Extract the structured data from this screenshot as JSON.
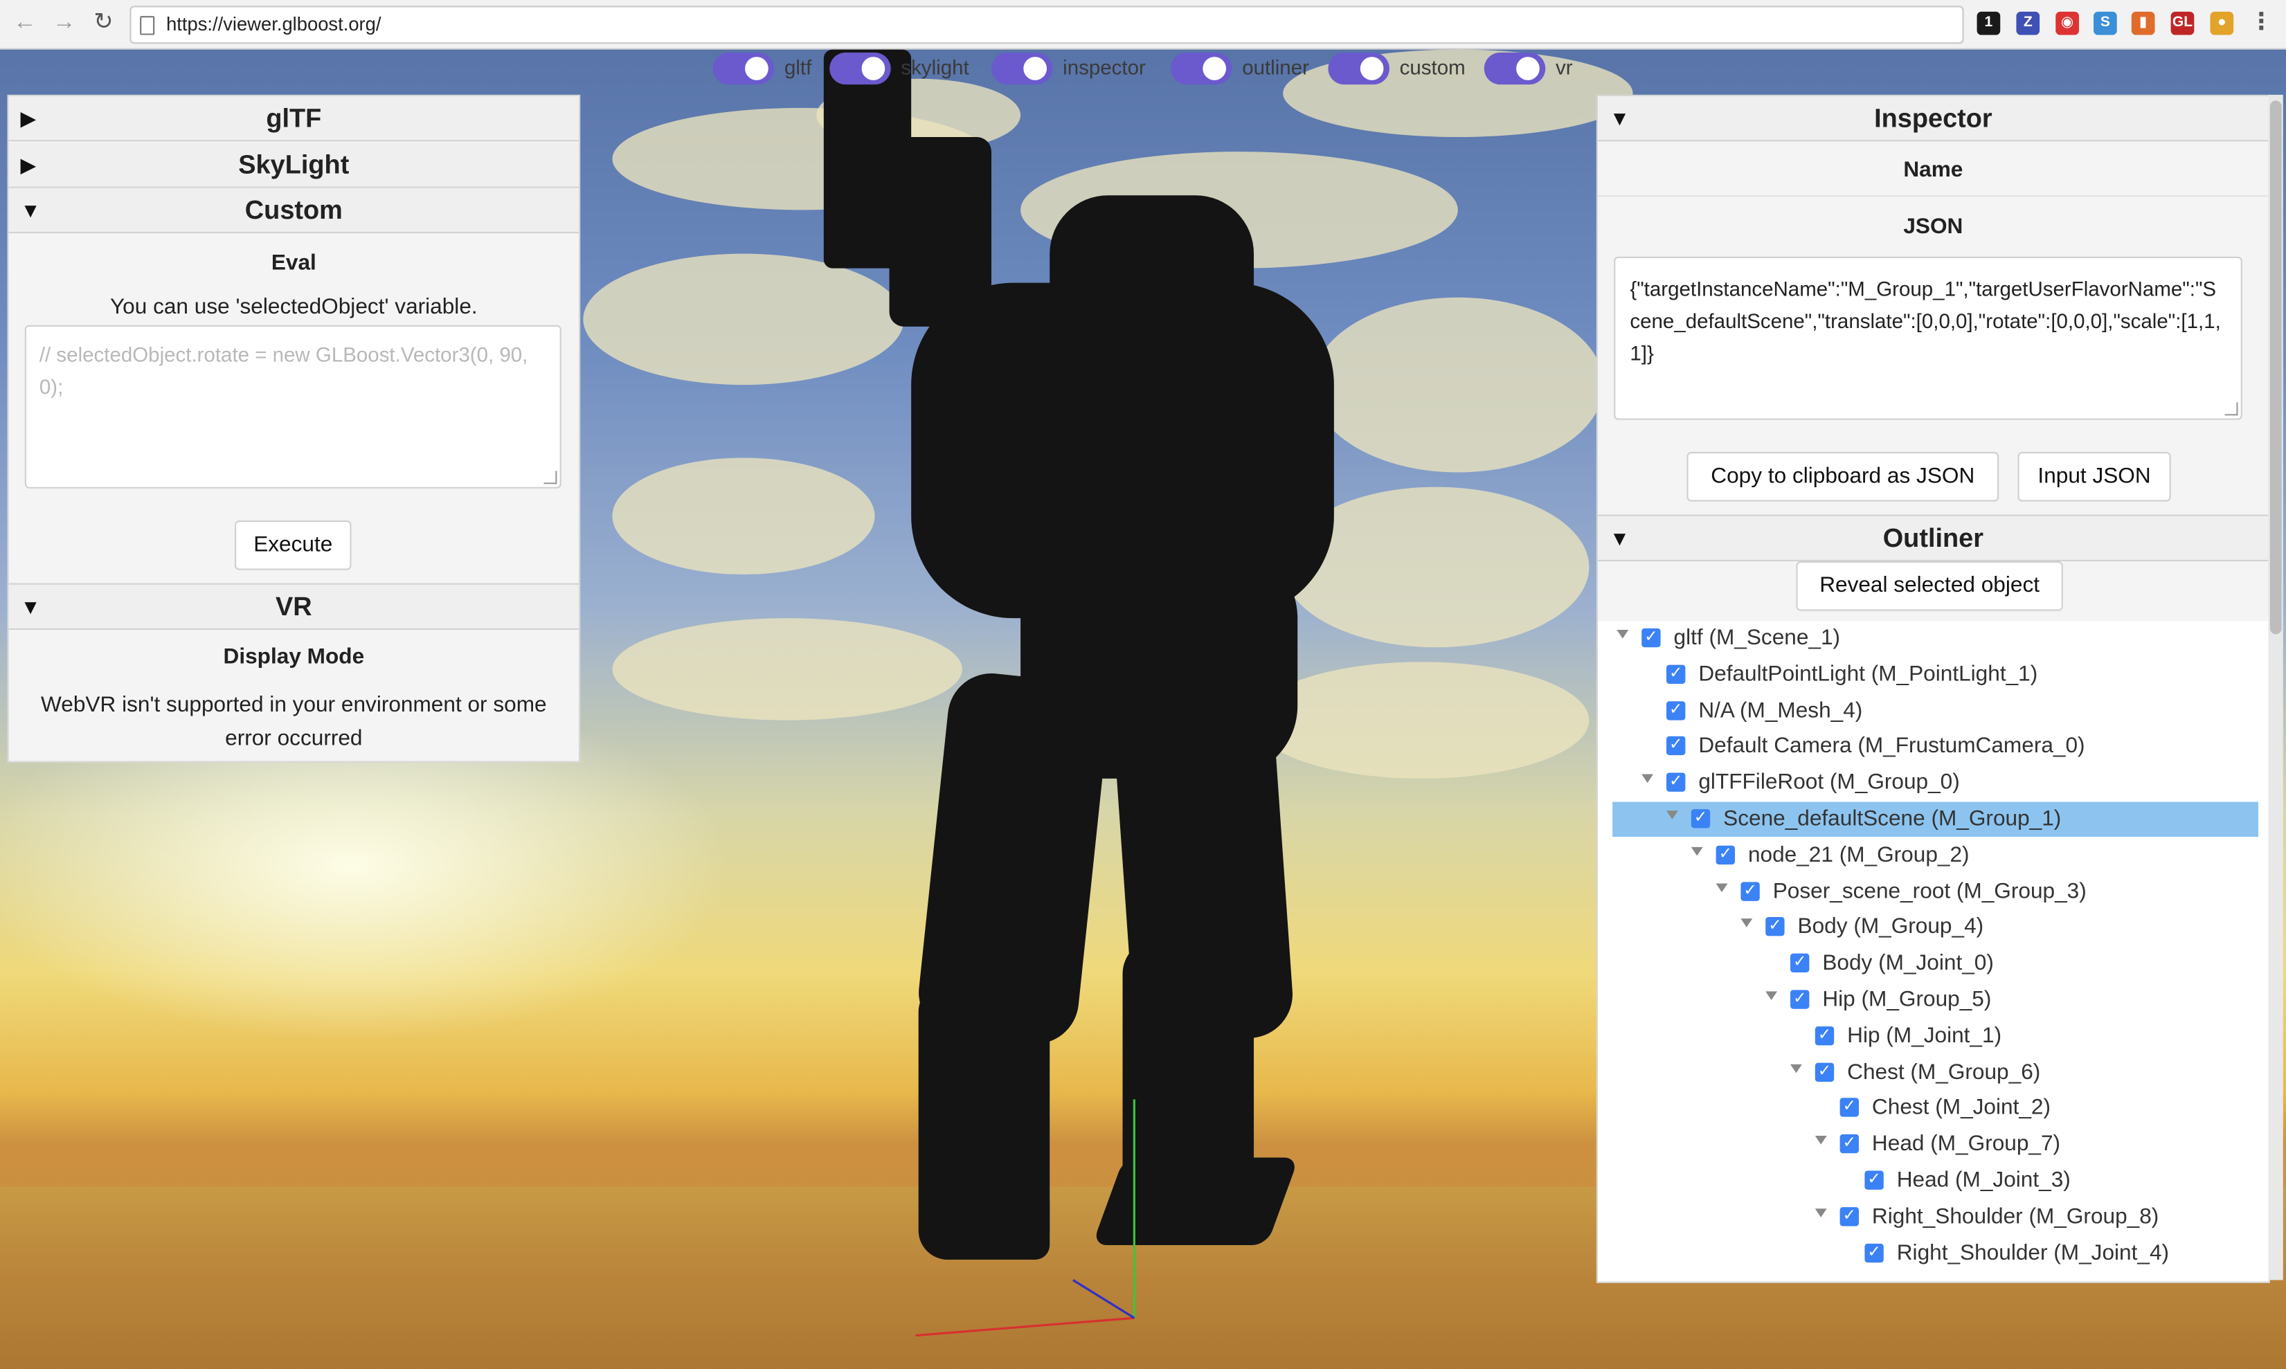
{
  "browser": {
    "url": "https://viewer.glboost.org/",
    "back_icon": "arrow-left-icon",
    "forward_icon": "arrow-right-icon",
    "reload_icon": "reload-icon",
    "menu_icon": "more-vertical-icon"
  },
  "extensions": [
    {
      "name": "1password-icon",
      "glyph": "1",
      "color": "#1a1a1a"
    },
    {
      "name": "z-extension-icon",
      "glyph": "Z",
      "color": "#3f51b5"
    },
    {
      "name": "shield-extension-icon",
      "glyph": "◉",
      "color": "#d33"
    },
    {
      "name": "s-extension-icon",
      "glyph": "S",
      "color": "#3a8fd6"
    },
    {
      "name": "office-extension-icon",
      "glyph": "▮",
      "color": "#e06c2b"
    },
    {
      "name": "gl-extension-icon",
      "glyph": "GL",
      "color": "#c02626"
    },
    {
      "name": "chrome-extension-icon",
      "glyph": "●",
      "color": "#e2a32b"
    }
  ],
  "toggles": [
    {
      "label": "gltf",
      "on": true
    },
    {
      "label": "skylight",
      "on": true
    },
    {
      "label": "inspector",
      "on": true
    },
    {
      "label": "outliner",
      "on": true
    },
    {
      "label": "custom",
      "on": true
    },
    {
      "label": "vr",
      "on": true
    }
  ],
  "left_panel": {
    "sections": {
      "gltf": "glTF",
      "skylight": "SkyLight",
      "custom": "Custom",
      "vr": "VR"
    },
    "custom": {
      "eval_title": "Eval",
      "hint": "You can use 'selectedObject' variable.",
      "placeholder": "// selectedObject.rotate = new GLBoost.Vector3(0, 90, 0);",
      "execute_label": "Execute"
    },
    "vr": {
      "display_mode_title": "Display Mode",
      "message": "WebVR isn't supported in your environment or some error occurred"
    }
  },
  "inspector": {
    "title": "Inspector",
    "name_label": "Name",
    "json_label": "JSON",
    "json_value": "{\"targetInstanceName\":\"M_Group_1\",\"targetUserFlavorName\":\"Scene_defaultScene\",\"translate\":[0,0,0],\"rotate\":[0,0,0],\"scale\":[1,1,1]}",
    "copy_label": "Copy to clipboard as JSON",
    "input_label": "Input JSON"
  },
  "outliner": {
    "title": "Outliner",
    "reveal_label": "Reveal selected object",
    "rows": [
      {
        "label": "gltf (M_Scene_1)",
        "depth": 0,
        "caret": true,
        "selected": false
      },
      {
        "label": "DefaultPointLight (M_PointLight_1)",
        "depth": 1,
        "caret": false,
        "selected": false
      },
      {
        "label": "N/A (M_Mesh_4)",
        "depth": 1,
        "caret": false,
        "selected": false
      },
      {
        "label": "Default Camera (M_FrustumCamera_0)",
        "depth": 1,
        "caret": false,
        "selected": false
      },
      {
        "label": "glTFFileRoot (M_Group_0)",
        "depth": 1,
        "caret": true,
        "selected": false
      },
      {
        "label": "Scene_defaultScene (M_Group_1)",
        "depth": 2,
        "caret": true,
        "selected": true
      },
      {
        "label": "node_21 (M_Group_2)",
        "depth": 3,
        "caret": true,
        "selected": false
      },
      {
        "label": "Poser_scene_root (M_Group_3)",
        "depth": 4,
        "caret": true,
        "selected": false
      },
      {
        "label": "Body (M_Group_4)",
        "depth": 5,
        "caret": true,
        "selected": false
      },
      {
        "label": "Body (M_Joint_0)",
        "depth": 6,
        "caret": false,
        "selected": false
      },
      {
        "label": "Hip (M_Group_5)",
        "depth": 6,
        "caret": true,
        "selected": false
      },
      {
        "label": "Hip (M_Joint_1)",
        "depth": 7,
        "caret": false,
        "selected": false
      },
      {
        "label": "Chest (M_Group_6)",
        "depth": 7,
        "caret": true,
        "selected": false
      },
      {
        "label": "Chest (M_Joint_2)",
        "depth": 8,
        "caret": false,
        "selected": false
      },
      {
        "label": "Head (M_Group_7)",
        "depth": 8,
        "caret": true,
        "selected": false
      },
      {
        "label": "Head (M_Joint_3)",
        "depth": 9,
        "caret": false,
        "selected": false
      },
      {
        "label": "Right_Shoulder (M_Group_8)",
        "depth": 8,
        "caret": true,
        "selected": false
      },
      {
        "label": "Right_Shoulder (M_Joint_4)",
        "depth": 9,
        "caret": false,
        "selected": false
      }
    ]
  }
}
